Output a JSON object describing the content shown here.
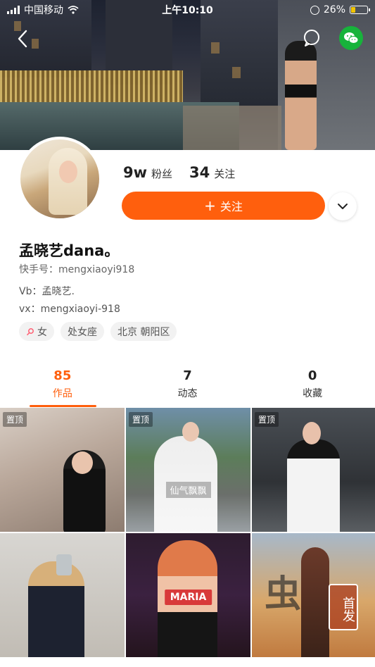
{
  "status_bar": {
    "carrier": "中国移动",
    "time": "上午10:10",
    "battery": "26%"
  },
  "profile": {
    "fans_count": "9w",
    "fans_label": "粉丝",
    "following_count": "34",
    "following_label": "关注",
    "follow_button": "关注",
    "name": "孟晓艺dana。",
    "uid": "快手号：mengxiaoyi918",
    "bio_line1": "Vb：孟晓艺.",
    "bio_line2": "vx：mengxiaoyi-918",
    "tags": [
      "女",
      "处女座",
      "北京 朝阳区"
    ]
  },
  "tabs": [
    {
      "count": "85",
      "label": "作品",
      "active": true
    },
    {
      "count": "7",
      "label": "动态",
      "active": false
    },
    {
      "count": "0",
      "label": "收藏",
      "active": false
    }
  ],
  "grid": {
    "pinned_label": "置顶",
    "caption_tile2": "仙气飘飘",
    "label_tile5": "MARIA",
    "label_tile6_big": "虫",
    "label_tile6_badge": "首发"
  },
  "colors": {
    "accent": "#ff5f0d",
    "wechat": "#17b33b"
  }
}
